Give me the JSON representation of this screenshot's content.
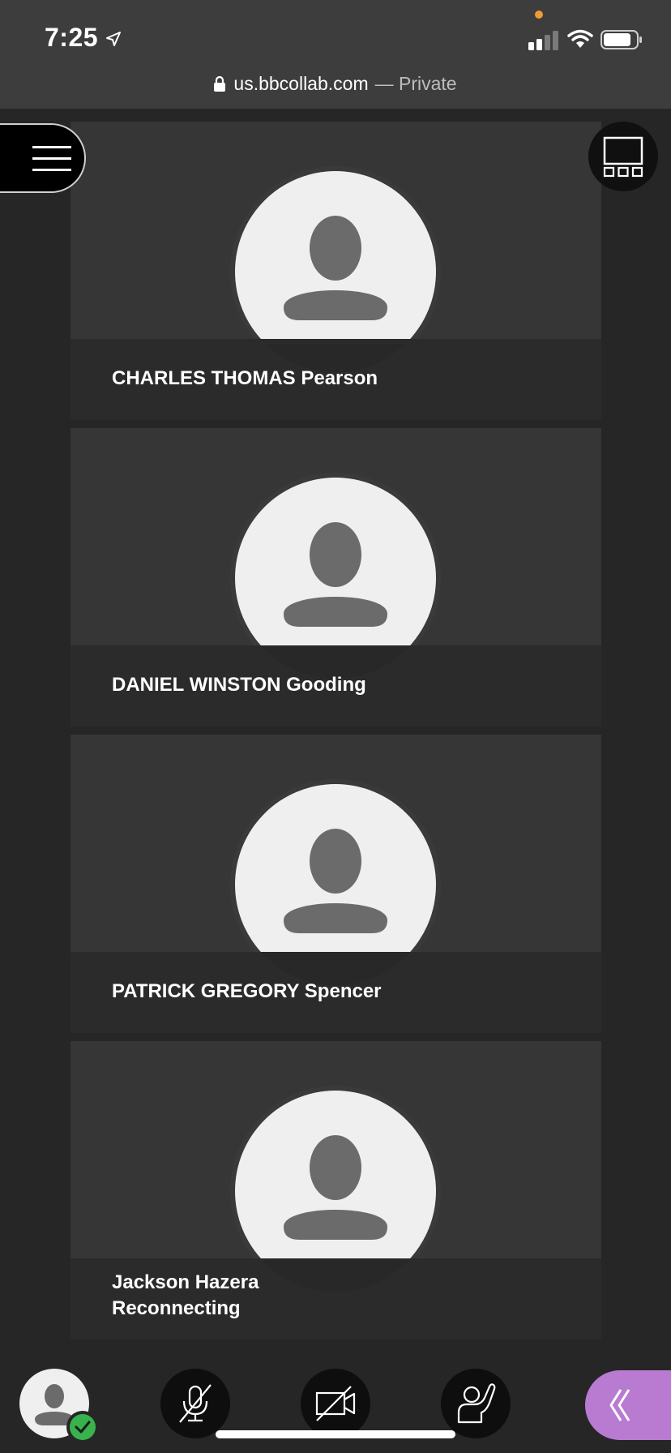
{
  "status_bar": {
    "time": "7:25",
    "icons": [
      "location-arrow-icon",
      "signal-icon",
      "wifi-icon",
      "battery-icon"
    ]
  },
  "browser": {
    "domain": "us.bbcollab.com",
    "mode": "— Private"
  },
  "participants": [
    {
      "name": "CHARLES THOMAS Pearson",
      "status": ""
    },
    {
      "name": "DANIEL WINSTON Gooding",
      "status": ""
    },
    {
      "name": "PATRICK GREGORY Spencer",
      "status": ""
    },
    {
      "name": "Jackson Hazera",
      "status": "Reconnecting"
    }
  ],
  "toolbar": {
    "icons": [
      "menu-icon",
      "layout-icon",
      "avatar-icon",
      "mic-off-icon",
      "camera-off-icon",
      "raise-hand-icon",
      "chevron-left-icon"
    ]
  },
  "colors": {
    "background": "#262626",
    "tile": "#363636",
    "avatar_bg": "#efefef",
    "avatar_silhouette": "#6b6b6b",
    "collab_accent": "#b97bd1",
    "status_green": "#37b24d"
  }
}
